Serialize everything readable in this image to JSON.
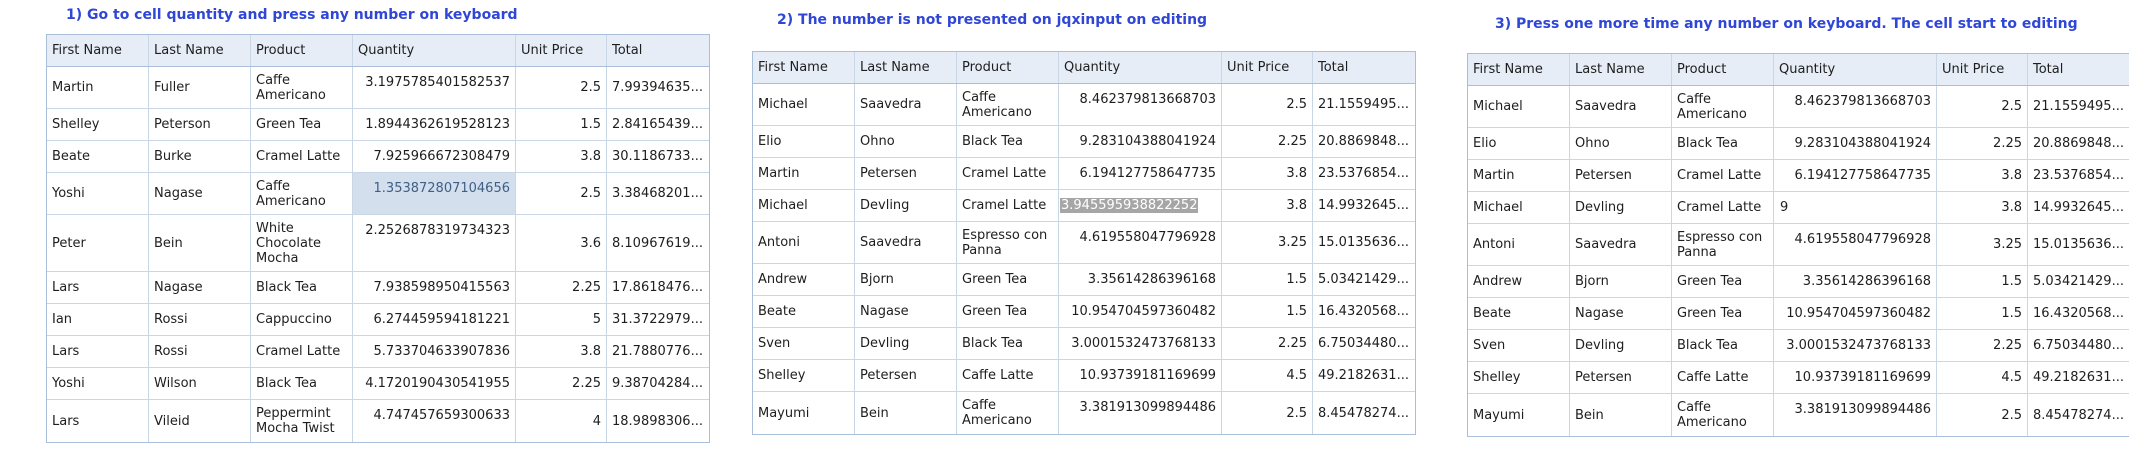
{
  "columns": [
    "First Name",
    "Last Name",
    "Product",
    "Quantity",
    "Unit Price",
    "Total"
  ],
  "panels": [
    {
      "caption": "1) Go to cell quantity and press any number on keyboard",
      "rows": [
        {
          "first": "Martin",
          "last": "Fuller",
          "product": "Caffe Americano",
          "quantity": "3.1975785401582537",
          "unit_price": "2.5",
          "total": "7.99394635..."
        },
        {
          "first": "Shelley",
          "last": "Peterson",
          "product": "Green Tea",
          "quantity": "1.8944362619528123",
          "unit_price": "1.5",
          "total": "2.84165439..."
        },
        {
          "first": "Beate",
          "last": "Burke",
          "product": "Cramel Latte",
          "quantity": "7.925966672308479",
          "unit_price": "3.8",
          "total": "30.1186733..."
        },
        {
          "first": "Yoshi",
          "last": "Nagase",
          "product": "Caffe Americano",
          "quantity": "1.353872807104656",
          "unit_price": "2.5",
          "total": "3.38468201..."
        },
        {
          "first": "Peter",
          "last": "Bein",
          "product": "White Chocolate Mocha",
          "quantity": "2.2526878319734323",
          "unit_price": "3.6",
          "total": "8.10967619..."
        },
        {
          "first": "Lars",
          "last": "Nagase",
          "product": "Black Tea",
          "quantity": "7.938598950415563",
          "unit_price": "2.25",
          "total": "17.8618476..."
        },
        {
          "first": "Ian",
          "last": "Rossi",
          "product": "Cappuccino",
          "quantity": "6.274459594181221",
          "unit_price": "5",
          "total": "31.3722979..."
        },
        {
          "first": "Lars",
          "last": "Rossi",
          "product": "Cramel Latte",
          "quantity": "5.733704633907836",
          "unit_price": "3.8",
          "total": "21.7880776..."
        },
        {
          "first": "Yoshi",
          "last": "Wilson",
          "product": "Black Tea",
          "quantity": "4.1720190430541955",
          "unit_price": "2.25",
          "total": "9.38704284..."
        },
        {
          "first": "Lars",
          "last": "Vileid",
          "product": "Peppermint Mocha Twist",
          "quantity": "4.747457659300633",
          "unit_price": "4",
          "total": "18.9898306..."
        }
      ]
    },
    {
      "caption": "2) The number is not presented on jqxinput on editing",
      "rows": [
        {
          "first": "Michael",
          "last": "Saavedra",
          "product": "Caffe Americano",
          "quantity": "8.462379813668703",
          "unit_price": "2.5",
          "total": "21.1559495..."
        },
        {
          "first": "Elio",
          "last": "Ohno",
          "product": "Black Tea",
          "quantity": "9.283104388041924",
          "unit_price": "2.25",
          "total": "20.8869848..."
        },
        {
          "first": "Martin",
          "last": "Petersen",
          "product": "Cramel Latte",
          "quantity": "6.194127758647735",
          "unit_price": "3.8",
          "total": "23.5376854..."
        },
        {
          "first": "Michael",
          "last": "Devling",
          "product": "Cramel Latte",
          "quantity": "3.945595938822252",
          "unit_price": "3.8",
          "total": "14.9932645..."
        },
        {
          "first": "Antoni",
          "last": "Saavedra",
          "product": "Espresso con Panna",
          "quantity": "4.619558047796928",
          "unit_price": "3.25",
          "total": "15.0135636..."
        },
        {
          "first": "Andrew",
          "last": "Bjorn",
          "product": "Green Tea",
          "quantity": "3.35614286396168",
          "unit_price": "1.5",
          "total": "5.03421429..."
        },
        {
          "first": "Beate",
          "last": "Nagase",
          "product": "Green Tea",
          "quantity": "10.954704597360482",
          "unit_price": "1.5",
          "total": "16.4320568..."
        },
        {
          "first": "Sven",
          "last": "Devling",
          "product": "Black Tea",
          "quantity": "3.0001532473768133",
          "unit_price": "2.25",
          "total": "6.75034480..."
        },
        {
          "first": "Shelley",
          "last": "Petersen",
          "product": "Caffe Latte",
          "quantity": "10.93739181169699",
          "unit_price": "4.5",
          "total": "49.2182631..."
        },
        {
          "first": "Mayumi",
          "last": "Bein",
          "product": "Caffe Americano",
          "quantity": "3.381913099894486",
          "unit_price": "2.5",
          "total": "8.45478274..."
        }
      ]
    },
    {
      "caption": "3) Press one more time any number on keyboard. The cell start to editing",
      "rows": [
        {
          "first": "Michael",
          "last": "Saavedra",
          "product": "Caffe Americano",
          "quantity": "8.462379813668703",
          "unit_price": "2.5",
          "total": "21.1559495..."
        },
        {
          "first": "Elio",
          "last": "Ohno",
          "product": "Black Tea",
          "quantity": "9.283104388041924",
          "unit_price": "2.25",
          "total": "20.8869848..."
        },
        {
          "first": "Martin",
          "last": "Petersen",
          "product": "Cramel Latte",
          "quantity": "6.194127758647735",
          "unit_price": "3.8",
          "total": "23.5376854..."
        },
        {
          "first": "Michael",
          "last": "Devling",
          "product": "Cramel Latte",
          "quantity": "9",
          "unit_price": "3.8",
          "total": "14.9932645..."
        },
        {
          "first": "Antoni",
          "last": "Saavedra",
          "product": "Espresso con Panna",
          "quantity": "4.619558047796928",
          "unit_price": "3.25",
          "total": "15.0135636..."
        },
        {
          "first": "Andrew",
          "last": "Bjorn",
          "product": "Green Tea",
          "quantity": "3.35614286396168",
          "unit_price": "1.5",
          "total": "5.03421429..."
        },
        {
          "first": "Beate",
          "last": "Nagase",
          "product": "Green Tea",
          "quantity": "10.954704597360482",
          "unit_price": "1.5",
          "total": "16.4320568..."
        },
        {
          "first": "Sven",
          "last": "Devling",
          "product": "Black Tea",
          "quantity": "3.0001532473768133",
          "unit_price": "2.25",
          "total": "6.75034480..."
        },
        {
          "first": "Shelley",
          "last": "Petersen",
          "product": "Caffe Latte",
          "quantity": "10.93739181169699",
          "unit_price": "4.5",
          "total": "49.2182631..."
        },
        {
          "first": "Mayumi",
          "last": "Bein",
          "product": "Caffe Americano",
          "quantity": "3.381913099894486",
          "unit_price": "2.5",
          "total": "8.45478274..."
        }
      ]
    }
  ]
}
